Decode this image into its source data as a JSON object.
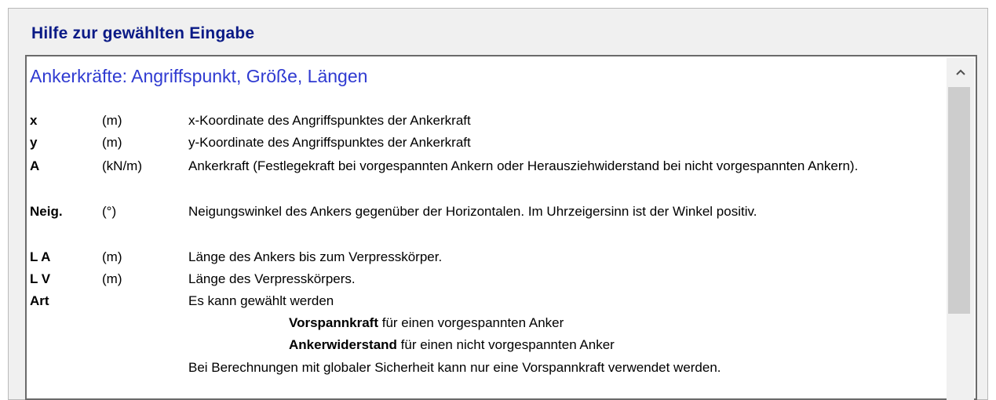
{
  "window": {
    "group_title": "Hilfe zur gewählten Eingabe"
  },
  "help": {
    "heading": "Ankerkräfte: Angriffspunkt, Größe, Längen",
    "rows": [
      {
        "symbol": "x",
        "unit": "(m)",
        "description": "x-Koordinate des Angriffspunktes der Ankerkraft"
      },
      {
        "symbol": "y",
        "unit": "(m)",
        "description": "y-Koordinate des Angriffspunktes der Ankerkraft"
      },
      {
        "symbol": "A",
        "unit": "(kN/m)",
        "description": "Ankerkraft (Festlegekraft bei vorgespannten Ankern oder Herausziehwiderstand bei nicht vorgespannten Ankern)."
      },
      {
        "symbol": "Neig.",
        "unit": "(°)",
        "description": "Neigungswinkel des Ankers gegenüber der Horizontalen. Im Uhrzeigersinn ist der Winkel positiv."
      },
      {
        "symbol": "L A",
        "unit": "(m)",
        "description": "Länge des Ankers bis zum Verpresskörper."
      },
      {
        "symbol": "L V",
        "unit": "(m)",
        "description": "Länge des Verpresskörpers."
      },
      {
        "symbol": "Art",
        "unit": "",
        "description": "Es kann gewählt werden"
      }
    ],
    "options": [
      {
        "term": "Vorspannkraft",
        "text": " für einen vorgespannten Anker"
      },
      {
        "term": "Ankerwiderstand",
        "text": " für einen nicht vorgespannten Anker"
      }
    ],
    "footer": "Bei Berechnungen mit globaler Sicherheit kann nur eine Vorspannkraft verwendet werden."
  },
  "icons": {
    "scroll_up": "chevron-up-icon"
  }
}
